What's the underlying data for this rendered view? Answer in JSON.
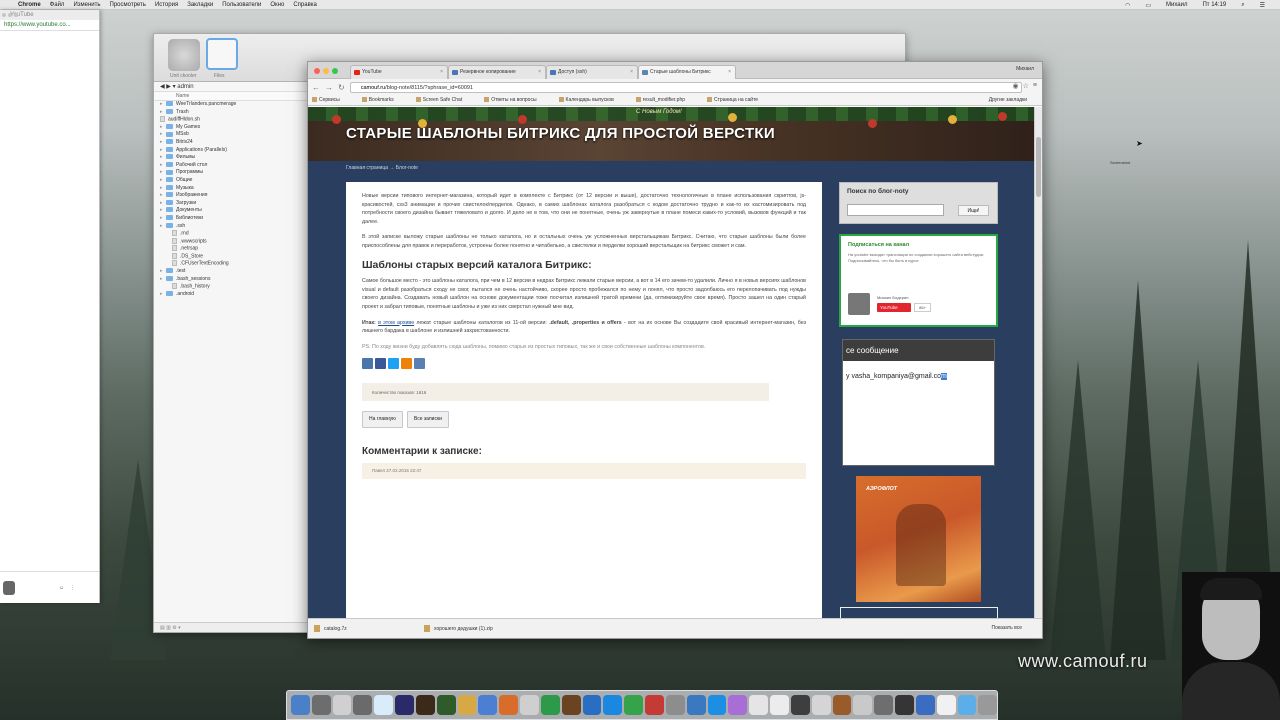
{
  "menubar": {
    "app": "Chrome",
    "items": [
      "Файл",
      "Изменить",
      "Просмотреть",
      "История",
      "Закладки",
      "Пользователи",
      "Окно",
      "Справка"
    ],
    "user": "Михаил",
    "time": "Пт 14:19"
  },
  "left_window": {
    "title": "YouTube",
    "url": "https://www.youtube.co..."
  },
  "finder": {
    "disk_label": "Unit ckooler",
    "files_label": "Files",
    "path": "admin",
    "column": "Name",
    "rows": [
      {
        "name": "WeeTrlanders.pancmerage",
        "type": "folder"
      },
      {
        "name": "Trash",
        "type": "folder"
      },
      {
        "name": "audiffHldon.sh",
        "type": "file"
      },
      {
        "name": "My Games",
        "type": "folder"
      },
      {
        "name": "MSsb",
        "type": "folder"
      },
      {
        "name": "Bitrix24",
        "type": "folder"
      },
      {
        "name": "Applications (Parallels)",
        "type": "folder"
      },
      {
        "name": "Фильмы",
        "type": "folder"
      },
      {
        "name": "Рабочий стол",
        "type": "folder"
      },
      {
        "name": "Программы",
        "type": "folder"
      },
      {
        "name": "Общие",
        "type": "folder"
      },
      {
        "name": "Музыка",
        "type": "folder"
      },
      {
        "name": "Изображения",
        "type": "folder"
      },
      {
        "name": "Загрузки",
        "type": "folder"
      },
      {
        "name": "Документы",
        "type": "folder"
      },
      {
        "name": "Библиотеки",
        "type": "folder"
      },
      {
        "name": ".ssh",
        "type": "folder"
      },
      {
        "name": ".rnd",
        "type": "sub"
      },
      {
        "name": ".wwwscripts",
        "type": "sub"
      },
      {
        "name": ".netrsap",
        "type": "sub"
      },
      {
        "name": ".DS_Store",
        "type": "sub"
      },
      {
        "name": ".CFUserTextEncoding",
        "type": "sub"
      },
      {
        "name": ".test",
        "type": "folder"
      },
      {
        "name": ".bash_sessions",
        "type": "folder"
      },
      {
        "name": ".bash_history",
        "type": "sub"
      },
      {
        "name": ".android",
        "type": "folder"
      }
    ]
  },
  "browser": {
    "user": "Михаил",
    "tabs": [
      {
        "label": "YouTube"
      },
      {
        "label": "Резервное копирование"
      },
      {
        "label": "Доступ (ssh)"
      },
      {
        "label": "Старые шаблоны Битрикс"
      }
    ],
    "url_host": "camouf.ru",
    "url_path": "/blog-note/8115/?sphrase_id=60091",
    "bookmarks": [
      "Сервисы",
      "Bookmarks",
      "Screen Safe Chat",
      "Ответы на вопросы",
      "Календарь выпусков",
      "result_modifier.php",
      "Страница на сайте"
    ],
    "other_bookmarks": "Другие закладки",
    "downloads": [
      "catalog.7z",
      "хорошего дедушки (1).zip"
    ],
    "show_all": "Показать все"
  },
  "page": {
    "banner_title": "СТАРЫЕ ШАБЛОНЫ БИТРИКС ДЛЯ ПРОСТОЙ ВЕРСТКИ",
    "banner_logo": "С Новым Годом!",
    "breadcrumb": "Главная страница → Блог-note",
    "p1": "Новые версии типового интернет-магазина, который идет в комплекте с Битрикс (от 12 версии и выше), достаточно технологичные в плане использования скриптов, js-красивостей, css3 анимации и прочих свистелок/перделок. Однако, в самих шаблонах каталога разобраться с кодом достаточно трудно и как-то их кастомизировать под потребности своего дизайна бывает тяжеловато и долго. И дело не в том, что они не понятные, очень уж завернутые в плане помеси каких-то условий, вызовов функций и так далее.",
    "p2": "В этой записке выложу старые шаблоны не только каталога, но и остальных очень уж усложненных верстальщикам Битрикс. Считаю, что старые шаблоны были более приспособлены для правок и переработок, устроены более понятно и читабельно, а свистелки и перделки хороший верстальщик на битрикс сможет и сам.",
    "h2": "Шаблоны старых версий каталога Битрикс:",
    "p3": "Самое большое место - это шаблоны каталога, при чем в 12 версии в недрах Битрикс лежали старые версии, а вот в 14 его зачем-то удалили. Лично я в новых версиях шаблонов visual и default разобраться сходу не смог, пытался не очень настойчиво, скорее просто пробежался по нему и понял, что просто задолбаюсь его перелопачивать под нужды своего дизайна. Создавать новый шаблон на основе документации тоже посчитал излишней тратой времени (да, оптимизируйте свое время). Просто зашел на один старый проект и забрал типовые, понятные шаблоны и уже из них сверстал нужный мне вид.",
    "p4_lead": "Итак:",
    "p4_link": "в этом архиве",
    "p4_mid": " лежат старые шаблоны каталогов из 11-ой версии: ",
    "p4_bold": ".default, .properties и offers",
    "p4_tail": " - вот на их основе Вы создадите свой красивый интернет-магазин, без лишнего бардака в шаблоне и излишней захристованности.",
    "ps": "PS: По ходу жизни буду добавлять сюда шаблоны, помимо старых из простых типовых, так же и свои собственные шаблоны компонентов.",
    "counter": "Количество показов: 1616",
    "btn_back": "На главную",
    "btn_all": "Все записки",
    "comments_h": "Комментарии к записке:",
    "comment_head": "Павел 27.02.2015 22:47"
  },
  "sidebar": {
    "search_title": "Поиск по блог-noty",
    "search_btn": "Ищи!",
    "subscribe_title": "Подписаться на канал",
    "subscribe_text": "На youtube выходят трансляции по созданию хорошего сайта вебстудии. Подписывайтесь, что бы быть в курсе",
    "channel_name": "Михаил Бодерин",
    "youtube_btn": "YouTube",
    "sub_count": "86+",
    "msg_title": "се сообщение",
    "msg_text_pre": "y  vasha_kompaniya@gmail.co",
    "msg_text_sel": "m",
    "ad_brand": "АЭРОФЛОТ"
  },
  "desktop": {
    "label": "Screenshot",
    "watermark": "www.camouf.ru"
  },
  "dock_colors": [
    "#4a80c8",
    "#6d6d6d",
    "#d0d0d0",
    "#6a6a6a",
    "#d9ecf9",
    "#2a2a6a",
    "#3b2a1a",
    "#2f5a2a",
    "#d7a844",
    "#4c7ed1",
    "#d76c2b",
    "#cfcfcf",
    "#2d9a4a",
    "#6a4420",
    "#2a6ec3",
    "#1a88e0",
    "#36a34a",
    "#c43a34",
    "#8d8d8d",
    "#3a78c2",
    "#1c8fe5",
    "#a96ed5",
    "#e5e5e5",
    "#ececec",
    "#3e3e3e",
    "#d5d5d5",
    "#9a5b2b",
    "#c9c9c9",
    "#6e6e6e",
    "#353535",
    "#3a6cc1",
    "#f1f1f1",
    "#5baee8",
    "#999999"
  ]
}
